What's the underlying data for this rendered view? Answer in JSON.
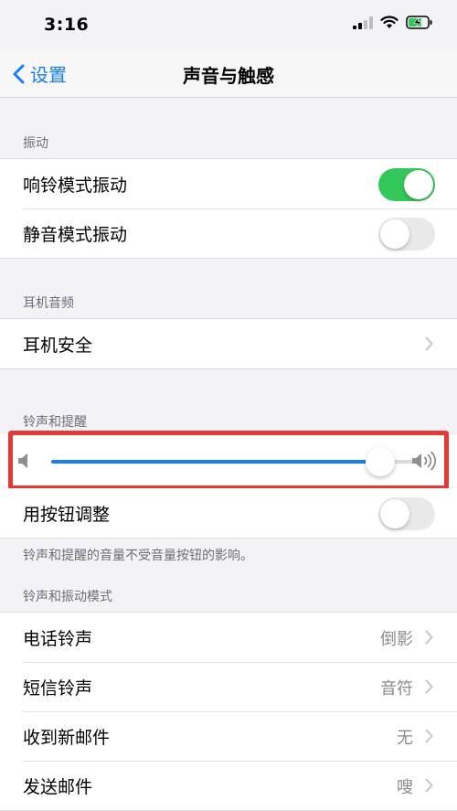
{
  "status_bar": {
    "time": "3:16"
  },
  "nav": {
    "back_label": "设置",
    "title": "声音与触感"
  },
  "vibration": {
    "header": "振动",
    "items": [
      {
        "label": "响铃模式振动",
        "on": true
      },
      {
        "label": "静音模式振动",
        "on": false
      }
    ]
  },
  "headphone": {
    "header": "耳机音频",
    "items": [
      {
        "label": "耳机安全"
      }
    ]
  },
  "ringer": {
    "header": "铃声和提醒",
    "volume": 0.9,
    "change_with_buttons": {
      "label": "用按钮调整",
      "on": false
    },
    "footnote": "铃声和提醒的音量不受音量按钮的影响。"
  },
  "patterns": {
    "header": "铃声和振动模式",
    "items": [
      {
        "label": "电话铃声",
        "value": "倒影"
      },
      {
        "label": "短信铃声",
        "value": "音符"
      },
      {
        "label": "收到新邮件",
        "value": "无"
      },
      {
        "label": "发送邮件",
        "value": "嗖"
      }
    ]
  },
  "colors": {
    "accent": "#1a7cf5",
    "toggle_on": "#34c759",
    "highlight": "#e53935"
  }
}
